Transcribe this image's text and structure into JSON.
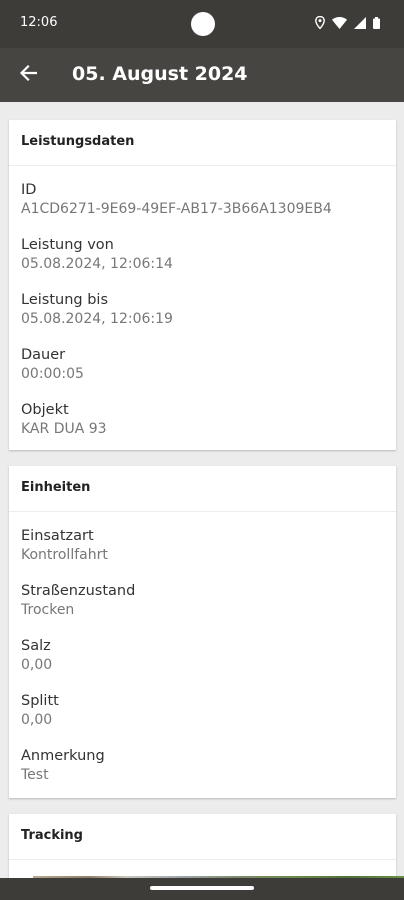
{
  "status_bar": {
    "time": "12:06",
    "icons": [
      "location-icon",
      "wifi-icon",
      "signal-icon",
      "battery-icon"
    ]
  },
  "app_bar": {
    "title": "05. August 2024",
    "back_icon": "arrow-back-icon"
  },
  "sections": [
    {
      "title": "Leistungsdaten",
      "fields": [
        {
          "label": "ID",
          "value": "A1CD6271-9E69-49EF-AB17-3B66A1309EB4"
        },
        {
          "label": "Leistung von",
          "value": "05.08.2024, 12:06:14"
        },
        {
          "label": "Leistung bis",
          "value": "05.08.2024, 12:06:19"
        },
        {
          "label": "Dauer",
          "value": "00:00:05"
        },
        {
          "label": "Objekt",
          "value": "KAR DUA 93"
        }
      ]
    },
    {
      "title": "Einheiten",
      "fields": [
        {
          "label": "Einsatzart",
          "value": "Kontrollfahrt"
        },
        {
          "label": "Straßenzustand",
          "value": "Trocken"
        },
        {
          "label": "Salz",
          "value": "0,00"
        },
        {
          "label": "Splitt",
          "value": "0,00"
        },
        {
          "label": "Anmerkung",
          "value": "Test"
        }
      ]
    },
    {
      "title": "Tracking"
    }
  ],
  "colors": {
    "status_bar": "#3e3c39",
    "app_bar": "#474542",
    "background": "#ececec",
    "card": "#ffffff"
  }
}
